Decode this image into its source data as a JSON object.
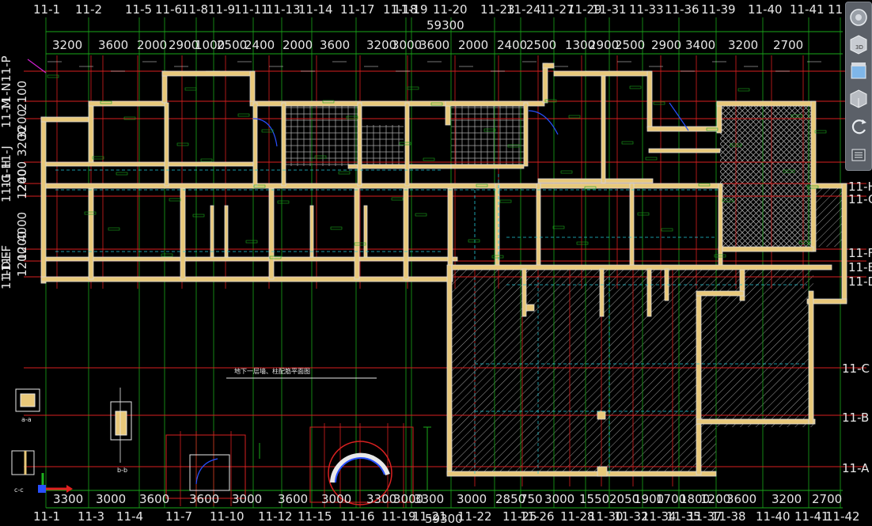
{
  "top_axis_labels": [
    "11-1",
    "11-2",
    "11-5",
    "11-6",
    "11-8",
    "11-9",
    "11-11",
    "11-13",
    "11-14",
    "11-17",
    "11-18",
    "11-19",
    "11-20",
    "11-23",
    "11-24",
    "11-27",
    "11-29",
    "11-31",
    "11-33",
    "11-36",
    "11-39",
    "11-40",
    "11-41",
    "11"
  ],
  "top_total_dimension": "59300",
  "top_dimensions": [
    "3200",
    "3600",
    "2000",
    "2900",
    "1000",
    "2500",
    "2400",
    "2000",
    "3600",
    "3200",
    "3000",
    "3600",
    "2000",
    "2400",
    "2500",
    "1300",
    "2900",
    "2500",
    "2900",
    "3400",
    "3200",
    "2700"
  ],
  "left_row_labels": [
    "11-P",
    "11-N",
    "11-M",
    "11-J",
    "11-H",
    "11-G",
    "11-F",
    "11-E",
    "11-D"
  ],
  "left_dimensions": [
    "2100",
    "3200",
    "3200",
    "1200",
    "2400",
    "4000",
    "1200",
    "1200"
  ],
  "right_row_labels": [
    "11-H",
    "11-G",
    "11-F",
    "11-E",
    "11-D",
    "11-C",
    "11-B",
    "11-A"
  ],
  "bottom_dimensions": [
    "3300",
    "3000",
    "3600",
    "3600",
    "3000",
    "3600",
    "3000",
    "3300",
    "3000",
    "3300",
    "3000",
    "2850",
    "750",
    "3000",
    "1550",
    "2050",
    "1900",
    "1700",
    "1800",
    "1200",
    "3600",
    "3200",
    "2700"
  ],
  "bottom_axis_labels": [
    "11-1",
    "11-3",
    "11-4",
    "11-7",
    "11-10",
    "11-12",
    "11-15",
    "11-16",
    "11-19",
    "11-21",
    "11-22",
    "11-25",
    "11-26",
    "11-28",
    "11-30",
    "11-32",
    "11-34",
    "11-35",
    "11-37",
    "11-38",
    "11-40",
    "11-41",
    "11-42"
  ],
  "bottom_total_dimension": "59300",
  "plan_caption": "地下一层墙、柱配筋平面图",
  "section_labels": [
    "a-a",
    "b-b",
    "c-c"
  ],
  "navigation_bar": {
    "items": [
      "steering-wheel",
      "view-cube-3d",
      "pan",
      "zoom",
      "orbit",
      "show-motion"
    ],
    "cube_label": "3D"
  },
  "colors": {
    "background": "#000000",
    "grid_axis": "#d82020",
    "grid_green": "#1aa81a",
    "wall_fill": "#e8c87a",
    "wall_edge": "#d9d9d9",
    "cyan": "#22c8d8",
    "blue": "#2850ff",
    "hatch": "#9a9a9a"
  }
}
